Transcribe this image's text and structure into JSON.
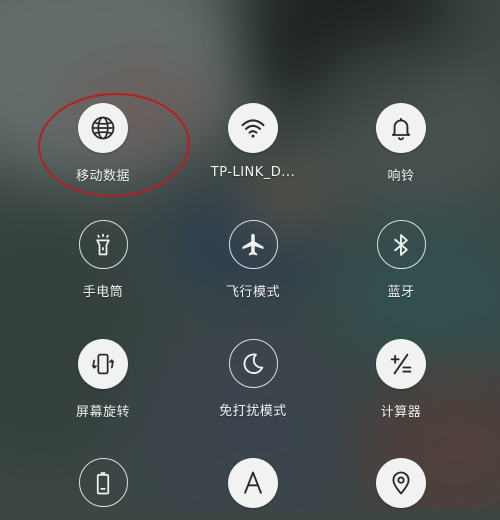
{
  "quick_settings": {
    "tiles": [
      {
        "label": "移动数据",
        "icon": "globe-icon",
        "active": true
      },
      {
        "label": "TP-LINK_D...",
        "icon": "wifi-icon",
        "active": true
      },
      {
        "label": "响铃",
        "icon": "bell-icon",
        "active": true
      },
      {
        "label": "手电筒",
        "icon": "flashlight-icon",
        "active": false
      },
      {
        "label": "飞行模式",
        "icon": "airplane-icon",
        "active": false
      },
      {
        "label": "蓝牙",
        "icon": "bluetooth-icon",
        "active": false
      },
      {
        "label": "屏幕旋转",
        "icon": "screen-rotation-icon",
        "active": true
      },
      {
        "label": "免打扰模式",
        "icon": "moon-icon",
        "active": false
      },
      {
        "label": "计算器",
        "icon": "calculator-icon",
        "active": true
      },
      {
        "label": "",
        "icon": "battery-icon",
        "active": false
      },
      {
        "label": "",
        "icon": "font-a-icon",
        "active": true
      },
      {
        "label": "",
        "icon": "location-pin-icon",
        "active": true
      }
    ]
  },
  "annotation": {
    "color": "#b42020"
  }
}
